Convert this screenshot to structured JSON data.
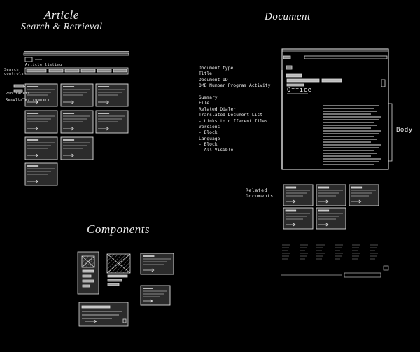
{
  "titles": {
    "article": "Article",
    "search": "Search & Retrieval",
    "document": "Document",
    "components": "Components"
  },
  "article": {
    "search_controls": "Search controls",
    "sort_label": "Article listing",
    "filter_note": "Pin facets",
    "result_note": "Results w/ summary"
  },
  "document": {
    "field_list": [
      "Document type",
      "Title",
      "Document ID",
      "OMB Number  Program Activity",
      "",
      "Summary",
      "File",
      "Related Dialer",
      "Translated Document List",
      "- Links to different files",
      "Versions",
      "- Block",
      "Language",
      "- Block",
      "- All Visible"
    ],
    "office_label": "Office",
    "body_label": "Body",
    "related_label": [
      "Related",
      "Documents"
    ]
  },
  "colors": {
    "background": "#000000",
    "ink": "#eeeeee",
    "card_fill": "#2b2b2b",
    "bar": "#bbbbbb"
  }
}
